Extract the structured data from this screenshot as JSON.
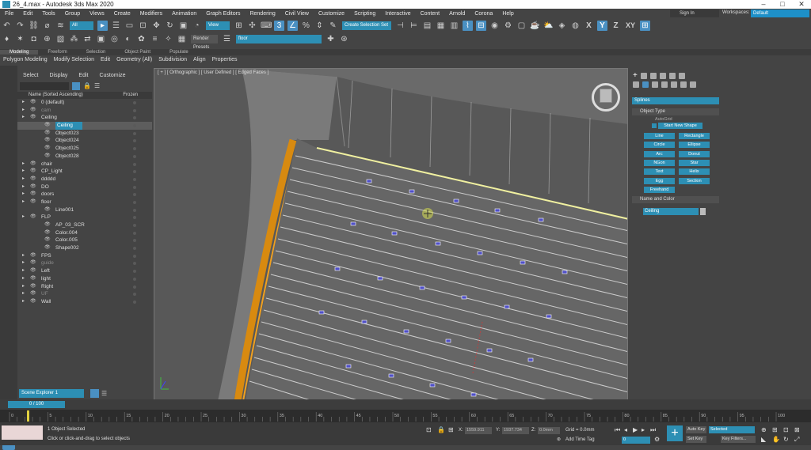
{
  "title": "26_4.max - Autodesk 3ds Max 2020",
  "menu": [
    "File",
    "Edit",
    "Tools",
    "Group",
    "Views",
    "Create",
    "Modifiers",
    "Animation",
    "Graph Editors",
    "Rendering",
    "Civil View",
    "Customize",
    "Scripting",
    "Interactive",
    "Content",
    "Arnold",
    "Corona",
    "Help"
  ],
  "signin": "Sign In",
  "workspaces_label": "Workspaces:",
  "workspace": "Default",
  "toolbar": {
    "filter": "All",
    "ref_coord": "View",
    "selection_set": "Create Selection Set",
    "axes": [
      "X",
      "Y",
      "Z",
      "XY"
    ],
    "render_preset": "Render Presets",
    "layer": "floor"
  },
  "ribbon": {
    "tabs": [
      "Modeling",
      "Freeform",
      "Selection",
      "Object Paint",
      "Populate"
    ],
    "items": [
      "Polygon Modeling",
      "Modify Selection",
      "Edit",
      "Geometry (All)",
      "Subdivision",
      "Align",
      "Properties"
    ]
  },
  "explorer": {
    "menu": [
      "Select",
      "Display",
      "Edit",
      "Customize"
    ],
    "col_name": "Name (Sorted Ascending)",
    "col_frozen": "Frozen",
    "rows": [
      {
        "name": "0 (default)",
        "indent": 0,
        "sel": false,
        "dim": false
      },
      {
        "name": "cam",
        "indent": 0,
        "sel": false,
        "dim": true
      },
      {
        "name": "Ceiling",
        "indent": 0,
        "sel": false,
        "dim": false
      },
      {
        "name": "Ceiling",
        "indent": 1,
        "sel": true,
        "dim": false
      },
      {
        "name": "Object023",
        "indent": 1,
        "sel": false,
        "dim": false
      },
      {
        "name": "Object024",
        "indent": 1,
        "sel": false,
        "dim": false
      },
      {
        "name": "Object025",
        "indent": 1,
        "sel": false,
        "dim": false
      },
      {
        "name": "Object028",
        "indent": 1,
        "sel": false,
        "dim": false
      },
      {
        "name": "chair",
        "indent": 0,
        "sel": false,
        "dim": false
      },
      {
        "name": "CP_Light",
        "indent": 0,
        "sel": false,
        "dim": false
      },
      {
        "name": "ddddd",
        "indent": 0,
        "sel": false,
        "dim": false
      },
      {
        "name": "DO",
        "indent": 0,
        "sel": false,
        "dim": false
      },
      {
        "name": "doors",
        "indent": 0,
        "sel": false,
        "dim": false
      },
      {
        "name": "floor",
        "indent": 0,
        "sel": false,
        "dim": false
      },
      {
        "name": "Line001",
        "indent": 1,
        "sel": false,
        "dim": false
      },
      {
        "name": "FLP",
        "indent": 0,
        "sel": false,
        "dim": false
      },
      {
        "name": "AP_03_SCR",
        "indent": 1,
        "sel": false,
        "dim": false
      },
      {
        "name": "Color.004",
        "indent": 1,
        "sel": false,
        "dim": false
      },
      {
        "name": "Color.005",
        "indent": 1,
        "sel": false,
        "dim": false
      },
      {
        "name": "Shape002",
        "indent": 1,
        "sel": false,
        "dim": false
      },
      {
        "name": "FPS",
        "indent": 0,
        "sel": false,
        "dim": false
      },
      {
        "name": "guide",
        "indent": 0,
        "sel": false,
        "dim": true
      },
      {
        "name": "Left",
        "indent": 0,
        "sel": false,
        "dim": false
      },
      {
        "name": "light",
        "indent": 0,
        "sel": false,
        "dim": false
      },
      {
        "name": "Right",
        "indent": 0,
        "sel": false,
        "dim": false
      },
      {
        "name": "UF",
        "indent": 0,
        "sel": false,
        "dim": true
      },
      {
        "name": "Wall",
        "indent": 0,
        "sel": false,
        "dim": false
      }
    ],
    "footer": "Scene Explorer 1"
  },
  "viewport_label": "[ + ] [ Orthographic ] [ User Defined ] [ Edged Faces ]",
  "command_panel": {
    "category": "Splines",
    "object_type": "Object Type",
    "autogrid": "AutoGrid",
    "start_new_shape": "Start New Shape",
    "buttons": [
      "Line",
      "Rectangle",
      "Circle",
      "Ellipse",
      "Arc",
      "Donut",
      "NGon",
      "Star",
      "Text",
      "Helix",
      "Egg",
      "Section",
      "Freehand"
    ],
    "name_color": "Name and Color",
    "name_value": "Ceiling"
  },
  "timeline": {
    "frame": "0 / 100",
    "ticks": [
      "0",
      "5",
      "10",
      "15",
      "20",
      "25",
      "30",
      "35",
      "40",
      "45",
      "50",
      "55",
      "60",
      "65",
      "70",
      "75",
      "80",
      "85",
      "90",
      "95",
      "100"
    ]
  },
  "status": {
    "selected": "1 Object Selected",
    "prompt": "Click or click-and-drag to select objects",
    "x_label": "X:",
    "x_value": "1559.911",
    "y_label": "Y:",
    "y_value": "1937.734",
    "z_label": "Z:",
    "z_value": "0.0mm",
    "grid": "Grid = 0.0mm",
    "add_time_tag": "Add Time Tag",
    "auto_key": "Auto Key",
    "set_key": "Set Key",
    "selected_dd": "Selected",
    "key_filters": "Key Filters...",
    "frame_field": "0"
  }
}
